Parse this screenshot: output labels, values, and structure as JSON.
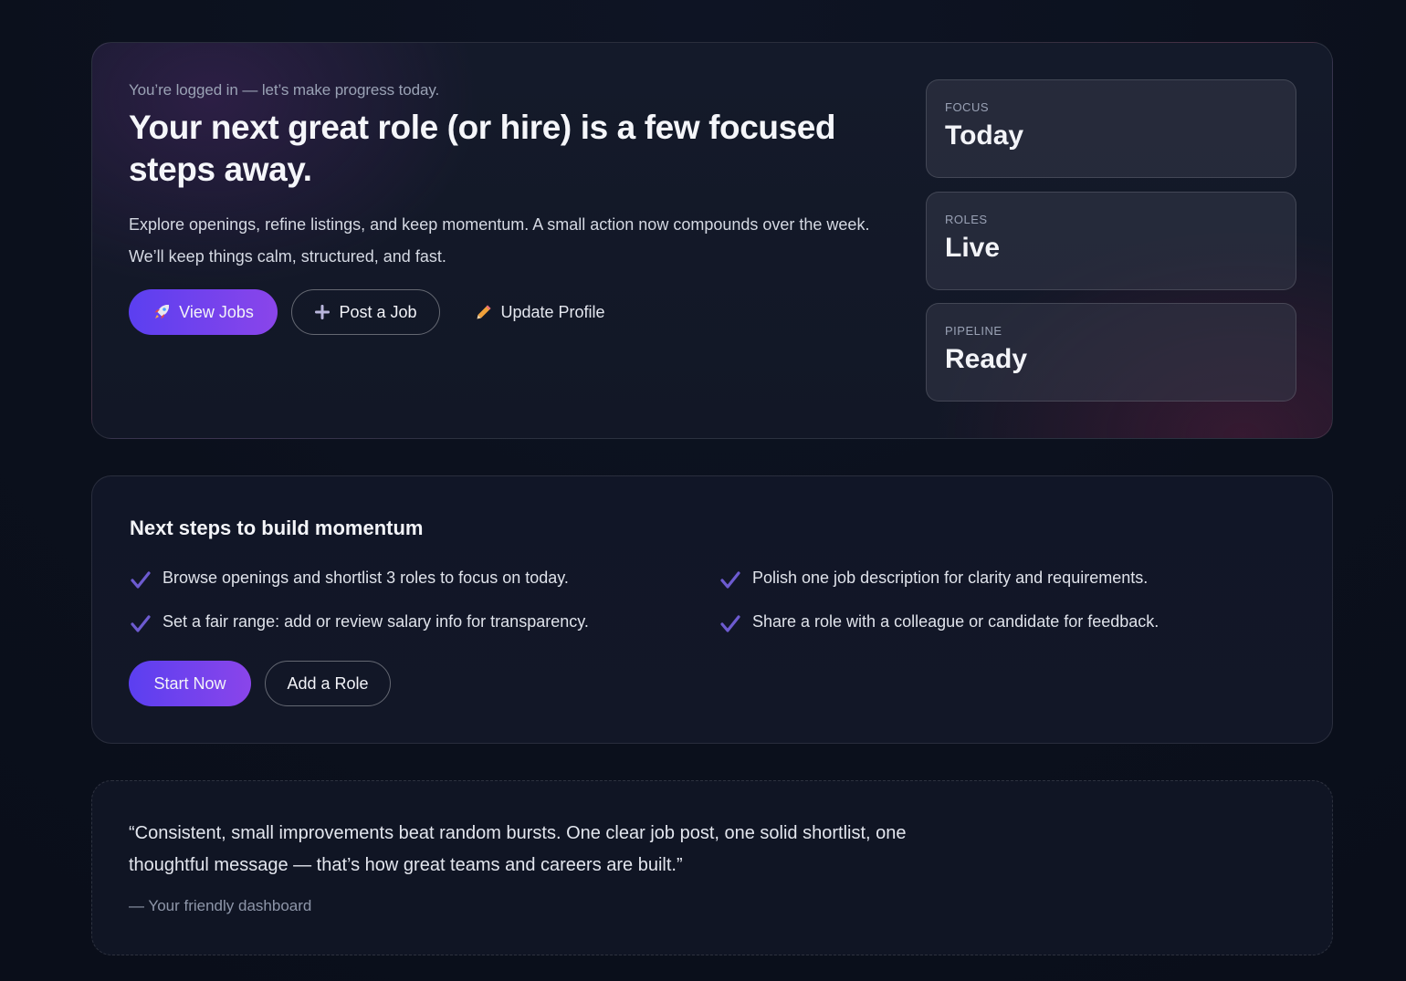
{
  "hero": {
    "eyebrow": "You’re logged in — let’s make progress today.",
    "title": "Your next great role (or hire) is a few focused steps away.",
    "description": "Explore openings, refine listings, and keep momentum. A small action now compounds over the week. We’ll keep things calm, structured, and fast.",
    "buttons": {
      "view_jobs": "View Jobs",
      "post_job": "Post a Job",
      "update_profile": "Update Profile"
    },
    "icons": {
      "view_jobs": "rocket-icon",
      "post_job": "plus-icon",
      "update_profile": "pencil-icon"
    }
  },
  "stats": [
    {
      "label": "FOCUS",
      "value": "Today"
    },
    {
      "label": "ROLES",
      "value": "Live"
    },
    {
      "label": "PIPELINE",
      "value": "Ready"
    }
  ],
  "steps": {
    "title": "Next steps to build momentum",
    "items": [
      "Browse openings and shortlist 3 roles to focus on today.",
      "Polish one job description for clarity and requirements.",
      "Set a fair range: add or review salary info for transparency.",
      "Share a role with a colleague or candidate for feedback."
    ],
    "buttons": {
      "start_now": "Start Now",
      "add_role": "Add a Role"
    }
  },
  "quote": {
    "text": "“Consistent, small improvements beat random bursts. One clear job post, one solid shortlist, one thoughtful message — that’s how great teams and careers are built.”",
    "attribution": "— Your friendly dashboard"
  },
  "colors": {
    "accent_start": "#5b3ff0",
    "accent_end": "#8a45ea",
    "check": "#6d5bd0",
    "background": "#0b101c"
  }
}
